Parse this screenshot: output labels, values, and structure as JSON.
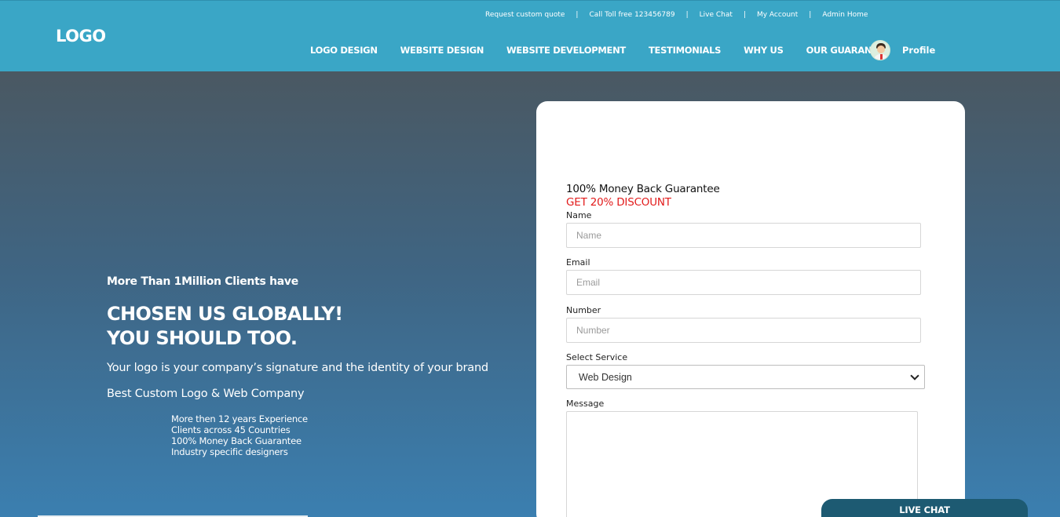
{
  "header": {
    "logo": "LOGO",
    "top_links": [
      "Request custom quote",
      "Call Toll free 123456789",
      "Live Chat",
      "My Account",
      "Admin Home"
    ],
    "nav": [
      "LOGO DESIGN",
      "WEBSITE DESIGN",
      "WEBSITE DEVELOPMENT",
      "TESTIMONIALS",
      "WHY US",
      "OUR GUARANTEE"
    ],
    "profile_label": "Profile",
    "background_color": "#3aa6c6"
  },
  "hero": {
    "subtitle": "More Than 1Million Clients have",
    "title_line1": "CHOSEN US GLOBALLY!",
    "title_line2": "YOU SHOULD TOO.",
    "description": "Your logo is your company’s signature and the identity of your brand",
    "company_line": "Best Custom Logo & Web Company",
    "features": [
      "More then 12 years Experience",
      "Clients across 45 Countries",
      "100% Money Back Guarantee",
      "Industry specific designers"
    ]
  },
  "form": {
    "heading": "100% Money Back Guarantee",
    "discount": "GET 20% DISCOUNT",
    "discount_color": "#e21b1b",
    "name_label": "Name",
    "name_placeholder": "Name",
    "email_label": "Email",
    "email_placeholder": "Email",
    "number_label": "Number",
    "number_placeholder": "Number",
    "service_label": "Select Service",
    "service_selected": "Web Design",
    "message_label": "Message"
  },
  "live_chat": {
    "label": "LIVE CHAT",
    "color": "#1d5a72"
  }
}
